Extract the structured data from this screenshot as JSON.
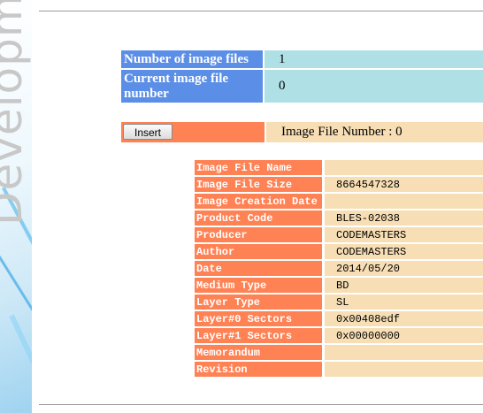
{
  "side_text": "Developme",
  "info": {
    "rows": [
      {
        "label": "Number of image files",
        "value": "1"
      },
      {
        "label": "Current image file number",
        "value": "0"
      }
    ]
  },
  "insert": {
    "button_label": "Insert",
    "status_text": "Image File Number : 0"
  },
  "details": {
    "rows": [
      {
        "key": "Image File Name",
        "value": ""
      },
      {
        "key": "Image File Size",
        "value": "8664547328"
      },
      {
        "key": "Image Creation Date",
        "value": ""
      },
      {
        "key": "Product Code",
        "value": "BLES-02038"
      },
      {
        "key": "Producer",
        "value": "CODEMASTERS"
      },
      {
        "key": "Author",
        "value": "CODEMASTERS"
      },
      {
        "key": "Date",
        "value": "2014/05/20"
      },
      {
        "key": "Medium Type",
        "value": "BD"
      },
      {
        "key": "Layer Type",
        "value": "SL"
      },
      {
        "key": "Layer#0 Sectors",
        "value": "0x00408edf"
      },
      {
        "key": "Layer#1 Sectors",
        "value": "0x00000000"
      },
      {
        "key": "Memorandum",
        "value": ""
      },
      {
        "key": "Revision",
        "value": ""
      }
    ]
  },
  "colors": {
    "label_blue": "#5b8ee6",
    "value_cyan": "#afe0e6",
    "orange": "#ff8255",
    "tan": "#f7deb5"
  }
}
